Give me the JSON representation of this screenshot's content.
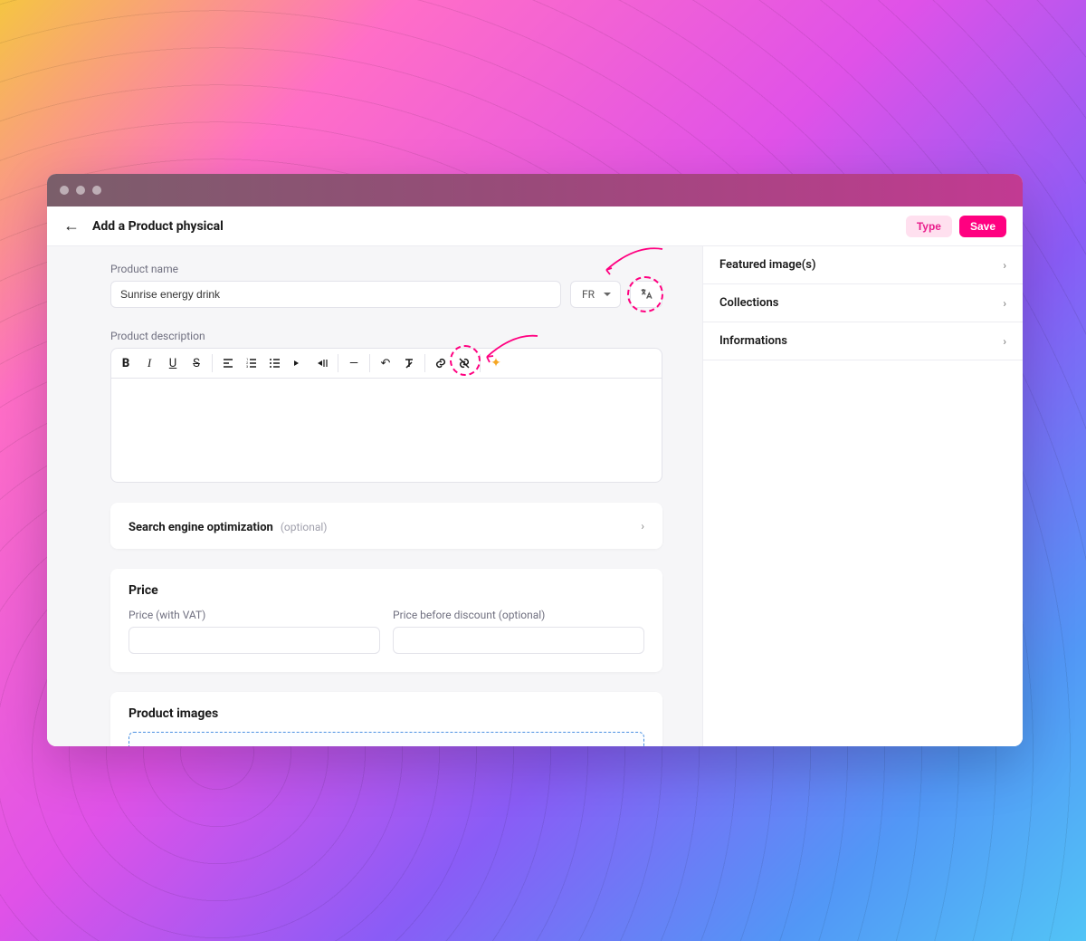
{
  "header": {
    "title": "Add a Product physical",
    "type_label": "Type",
    "save_label": "Save"
  },
  "form": {
    "name_label": "Product name",
    "name_value": "Sunrise energy drink",
    "lang_selected": "FR",
    "desc_label": "Product description",
    "seo_title": "Search engine optimization",
    "seo_optional": "(optional)",
    "price_heading": "Price",
    "price_vat_label": "Price (with VAT)",
    "price_before_label": "Price before discount (optional)",
    "images_heading": "Product images"
  },
  "toolbar": {
    "bold": "B",
    "italic": "I",
    "underline": "U",
    "strike": "S",
    "align": "≡",
    "olist": "≡",
    "ulist": "≡",
    "indent": "▶",
    "outdent": "◀⁞",
    "hr": "—",
    "undo": "↶",
    "clear": "Ͳ",
    "link": "⫘",
    "unlink": "⫘",
    "ai": "✦"
  },
  "sidebar": {
    "items": [
      {
        "label": "Featured image(s)"
      },
      {
        "label": "Collections"
      },
      {
        "label": "Informations"
      }
    ]
  },
  "colors": {
    "accent": "#ff0080",
    "ai": "#f5a623"
  }
}
